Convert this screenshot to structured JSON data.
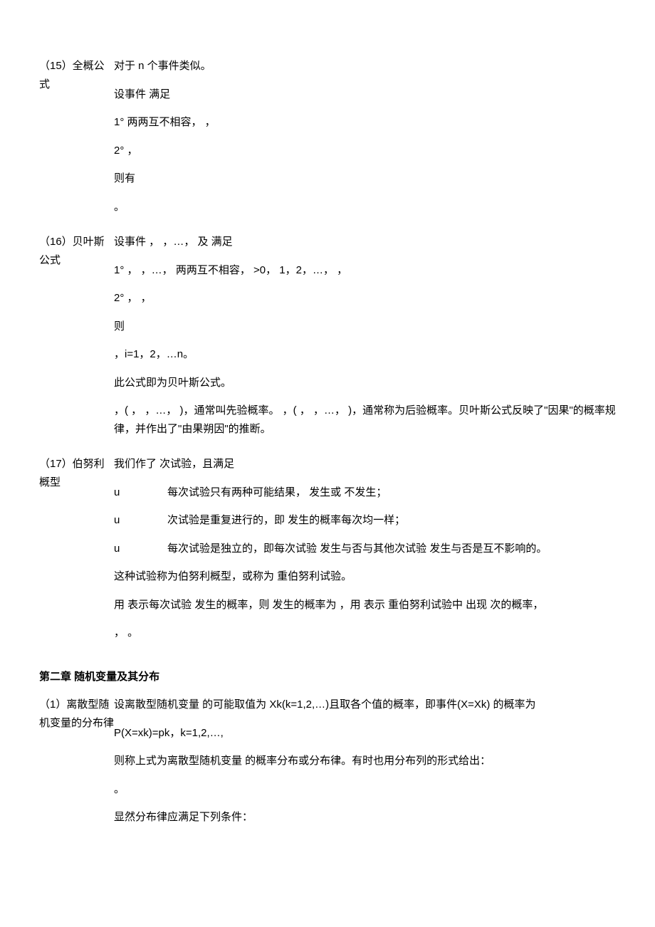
{
  "section15": {
    "label": "（15）全概公式",
    "p1": "对于 n 个事件类似。",
    "p2": "设事件  满足",
    "p3": "1°  两两互不相容，  ，",
    "p4": "2°  ，",
    "p5": "则有",
    "p6": "。"
  },
  "section16": {
    "label": "（16）贝叶斯公式",
    "p1": "设事件  ，  ，…，     及  满足",
    "p2": "1°   ，  ，…，    两两互不相容，   >0，   1，2，…，   ，",
    "p3": "2°   ，   ，",
    "p4": "则",
    "p5": "，i=1，2，…n。",
    "p6": "此公式即为贝叶斯公式。",
    "p7": "，(  ，  ，…，   )，通常叫先验概率。  ，(  ，  ，…，   )，通常称为后验概率。贝叶斯公式反映了\"因果\"的概率规律，并作出了\"由果朔因\"的推断。"
  },
  "section17": {
    "label": "（17）伯努利概型",
    "p1": "我们作了  次试验，且满足",
    "u": "u",
    "u1": "每次试验只有两种可能结果，  发生或  不发生；",
    "u2": "次试验是重复进行的，即  发生的概率每次均一样；",
    "u3": "每次试验是独立的，即每次试验  发生与否与其他次试验  发生与否是互不影响的。",
    "p2": "这种试验称为伯努利概型，或称为  重伯努利试验。",
    "p3": "用  表示每次试验  发生的概率，则  发生的概率为  ，用  表示  重伯努利试验中  出现  次的概率，",
    "p4": "，    。"
  },
  "chapter2": "第二章    随机变量及其分布",
  "section_ch2_1": {
    "label": "（1）离散型随机变量的分布律",
    "p1": "设离散型随机变量  的可能取值为 Xk(k=1,2,…)且取各个值的概率，即事件(X=Xk) 的概率为",
    "p2": "P(X=xk)=pk，k=1,2,…,",
    "p3": "则称上式为离散型随机变量  的概率分布或分布律。有时也用分布列的形式给出：",
    "p4": "。",
    "p5": "显然分布律应满足下列条件："
  }
}
